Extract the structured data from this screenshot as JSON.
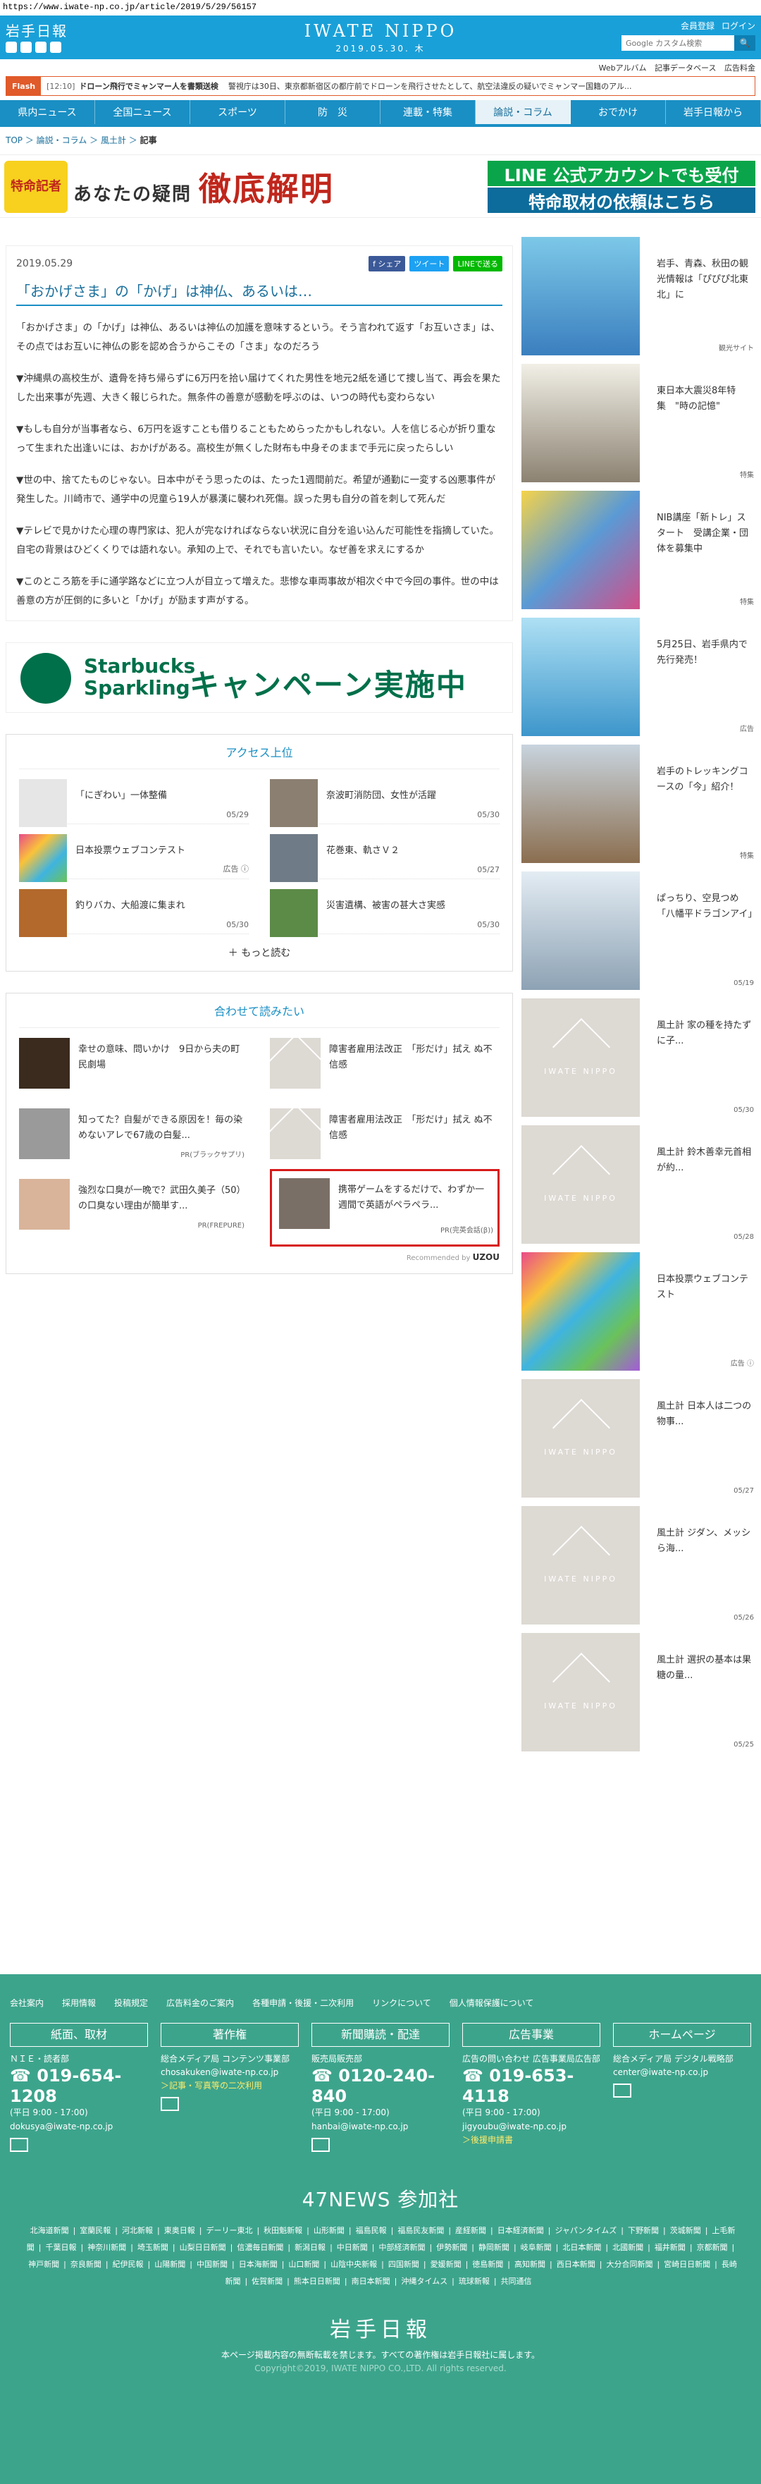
{
  "url": "https://www.iwate-np.co.jp/article/2019/5/29/56157",
  "header": {
    "logo": "岩手日報",
    "site_name": "IWATE NIPPO",
    "date": "2019.05.30. 木",
    "links": [
      "会員登録",
      "ログイン"
    ],
    "search_placeholder": "Google カスタム検索",
    "search_button": "🔍"
  },
  "subnav": [
    "Webアルバム",
    "記事データベース",
    "広告料金"
  ],
  "flash": {
    "label": "Flash",
    "time": "[12:10]",
    "headline": "ドローン飛行でミャンマー人を書類送検",
    "text": "警視庁は30日、東京都新宿区の都庁前でドローンを飛行させたとして、航空法違反の疑いでミャンマー国籍のアル..."
  },
  "gnav": [
    "県内ニュース",
    "全国ニュース",
    "スポーツ",
    "防　災",
    "連載・特集",
    "論説・コラム",
    "おでかけ",
    "岩手日報から"
  ],
  "gnav_active": 5,
  "breadcrumb": {
    "items": [
      "TOP",
      "論説・コラム",
      "風土計"
    ],
    "current": "記事"
  },
  "banner": {
    "badge": "特命記者",
    "question": "あなたの疑問",
    "title": "徹底解明",
    "btn1": "LINE 公式アカウントでも受付",
    "btn2": "特命取材の依頼はこちら"
  },
  "article": {
    "date": "2019.05.29",
    "share": [
      "f シェア",
      "ツイート",
      "LINEで送る"
    ],
    "title": "「おかげさま」の「かげ」は神仏、あるいは…",
    "paragraphs": [
      "「おかげさま」の「かげ」は神仏、あるいは神仏の加護を意味するという。そう言われて返す「お互いさま」は、その点ではお互いに神仏の影を認め合うからこその「さま」なのだろう",
      "▼沖縄県の高校生が、遺骨を持ち帰らずに6万円を拾い届けてくれた男性を地元2紙を通じて捜し当て、再会を果たした出来事が先週、大きく報じられた。無条件の善意が感動を呼ぶのは、いつの時代も変わらない",
      "▼もしも自分が当事者なら、6万円を返すことも借りることもためらったかもしれない。人を信じる心が折り重なって生まれた出逢いには、おかげがある。高校生が無くした財布も中身そのままで手元に戻ったらしい",
      "▼世の中、捨てたものじゃない。日本中がそう思ったのは、たった1週間前だ。希望が通勤に一変する凶悪事件が発生した。川崎市で、通学中の児童ら19人が暴漢に襲われ死傷。誤った男も自分の首を刺して死んだ",
      "▼テレビで見かけた心理の専門家は、犯人が完なければならない状況に自分を追い込んだ可能性を指摘していた。自宅の背景はひどくくりでは語れない。承知の上で、それでも言いたい。なぜ善を求えにするか",
      "▼このところ筋を手に通学路などに立つ人が目立って増えた。悲惨な車両事故が相次ぐ中で今回の事件。世の中は善意の方が圧倒的に多いと「かげ」が励ます声がする。"
    ]
  },
  "ad": {
    "brand": "Starbucks",
    "product": "Sparkling",
    "campaign": "キャンペーン実施中"
  },
  "ranking": {
    "title": "アクセス上位",
    "items": [
      {
        "title": "「にぎわい」一体整備",
        "date": "05/29"
      },
      {
        "title": "奈波町消防団、女性が活躍",
        "date": "05/30"
      },
      {
        "title": "日本投票ウェブコンテスト",
        "date": "広告 ⓘ"
      },
      {
        "title": "花巻東、軌さＶ２",
        "date": "05/27"
      },
      {
        "title": "釣りバカ、大船渡に集まれ",
        "date": "05/30"
      },
      {
        "title": "災害遺構、被害の甚大さ実感",
        "date": "05/30"
      }
    ],
    "more": "もっと読む"
  },
  "recommend": {
    "title": "合わせて読みたい",
    "items": [
      {
        "title": "幸せの意味、問いかけ　9日から夫の町民劇場",
        "pr": ""
      },
      {
        "title": "障害者雇用法改正　「形だけ」拭え ぬ不信感",
        "pr": ""
      },
      {
        "title": "知ってた？自髪ができる原因を！毎の染めないアレで67歳の白髪...",
        "pr": "PR(ブラックサプリ)"
      },
      {
        "title": "障害者雇用法改正　「形だけ」拭え ぬ不信感",
        "pr": ""
      },
      {
        "title": "強烈な口臭が一晩で？武田久美子（50）の口臭ない理由が簡単す...",
        "pr": "PR(FREPURE)"
      },
      {
        "title": "携帯ゲームをするだけで、わずか一週間で英語がペラペラ...",
        "pr": "PR(完英会話(β))"
      }
    ],
    "powered": "Recommended by",
    "powered_brand": "UZOU"
  },
  "sidebar": [
    {
      "text": "岩手、青森、秋田の観光情報は「ぴぴぴ北東北」に",
      "foot": "観光サイト"
    },
    {
      "text": "東日本大震災8年特集　\"時の記憶\"",
      "foot": "特集"
    },
    {
      "text": "NIB講座「新トレ」スタート　受講企業・団体を募集中",
      "foot": "特集"
    },
    {
      "text": "5月25日、岩手県内で先行発売！",
      "foot": "広告"
    },
    {
      "text": "岩手のトレッキングコースの「今」紹介！",
      "foot": "特集"
    },
    {
      "text": "ぱっちり、空見つめ「八幡平ドラゴンアイ」",
      "foot": "05/19"
    },
    {
      "text": "風土計 家の種を持たずに子...",
      "foot": "05/30"
    },
    {
      "text": "風土計 鈴木善幸元首相が約...",
      "foot": "05/28"
    },
    {
      "text": "日本投票ウェブコンテスト",
      "foot": "広告 ⓘ"
    },
    {
      "text": "風土計 日本人は二つの物事...",
      "foot": "05/27"
    },
    {
      "text": "風土計 ジダン、メッシら海...",
      "foot": "05/26"
    },
    {
      "text": "風土計 選択の基本は果糖の量...",
      "foot": "05/25"
    }
  ],
  "placeholder_label": "IWATE NIPPO",
  "footer": {
    "links": [
      "会社案内",
      "採用情報",
      "投稿規定",
      "広告料金のご案内",
      "各種申請・後援・二次利用",
      "リンクについて",
      "個人情報保護について"
    ],
    "cols": [
      {
        "head": "紙面、取材",
        "l1": "ＮＩＥ・読者部",
        "tel": "019-654-1208",
        "hours": "(平日 9:00 - 17:00)",
        "mail": "dokusya@iwate-np.co.jp",
        "extra": ""
      },
      {
        "head": "著作権",
        "l1": "総合メディア局 コンテンツ事業部",
        "tel": "",
        "hours": "",
        "mail": "chosakuken@iwate-np.co.jp",
        "extra": "＞記事・写真等の二次利用"
      },
      {
        "head": "新聞購読・配達",
        "l1": "販売局販売部",
        "tel": "0120-240-840",
        "hours": "(平日 9:00 - 17:00)",
        "mail": "hanbai@iwate-np.co.jp",
        "extra": ""
      },
      {
        "head": "広告事業",
        "l1": "広告の問い合わせ 広告事業局広告部",
        "tel": "019-653-4118",
        "hours": "(平日 9:00 - 17:00)",
        "mail": "jigyoubu@iwate-np.co.jp",
        "extra": "＞後援申請書"
      },
      {
        "head": "ホームページ",
        "l1": "総合メディア局 デジタル戦略部",
        "tel": "",
        "hours": "",
        "mail": "center@iwate-np.co.jp",
        "extra": ""
      }
    ],
    "news47": "47NEWS 参加社",
    "papers": [
      "北海道新聞",
      "室蘭民報",
      "河北新報",
      "東奥日報",
      "デーリー東北",
      "秋田魁新報",
      "山形新聞",
      "福島民報",
      "福島民友新聞",
      "産経新聞",
      "日本経済新聞",
      "ジャパンタイムズ",
      "下野新聞",
      "茨城新聞",
      "上毛新聞",
      "千葉日報",
      "神奈川新聞",
      "埼玉新聞",
      "山梨日日新聞",
      "信濃毎日新聞",
      "新潟日報",
      "中日新聞",
      "中部経済新聞",
      "伊勢新聞",
      "静岡新聞",
      "岐阜新聞",
      "北日本新聞",
      "北國新聞",
      "福井新聞",
      "京都新聞",
      "神戸新聞",
      "奈良新聞",
      "紀伊民報",
      "山陽新聞",
      "中国新聞",
      "日本海新聞",
      "山口新聞",
      "山陰中央新報",
      "四国新聞",
      "愛媛新聞",
      "徳島新聞",
      "高知新聞",
      "西日本新聞",
      "大分合同新聞",
      "宮崎日日新聞",
      "長崎新聞",
      "佐賀新聞",
      "熊本日日新聞",
      "南日本新聞",
      "沖縄タイムス",
      "琉球新報",
      "共同通信"
    ],
    "logo": "岩手日報",
    "copy1": "本ページ掲載内容の無断転載を禁じます。すべての著作権は岩手日報社に属します。",
    "copy2": "Copyright©2019, IWATE NIPPO CO.,LTD. All rights reserved."
  },
  "colors": {
    "brand": "#1aa0d8",
    "nav": "#1a8fc4",
    "footer": "#3da48c",
    "flash": "#e05a2a",
    "highlight": "#d71919"
  }
}
